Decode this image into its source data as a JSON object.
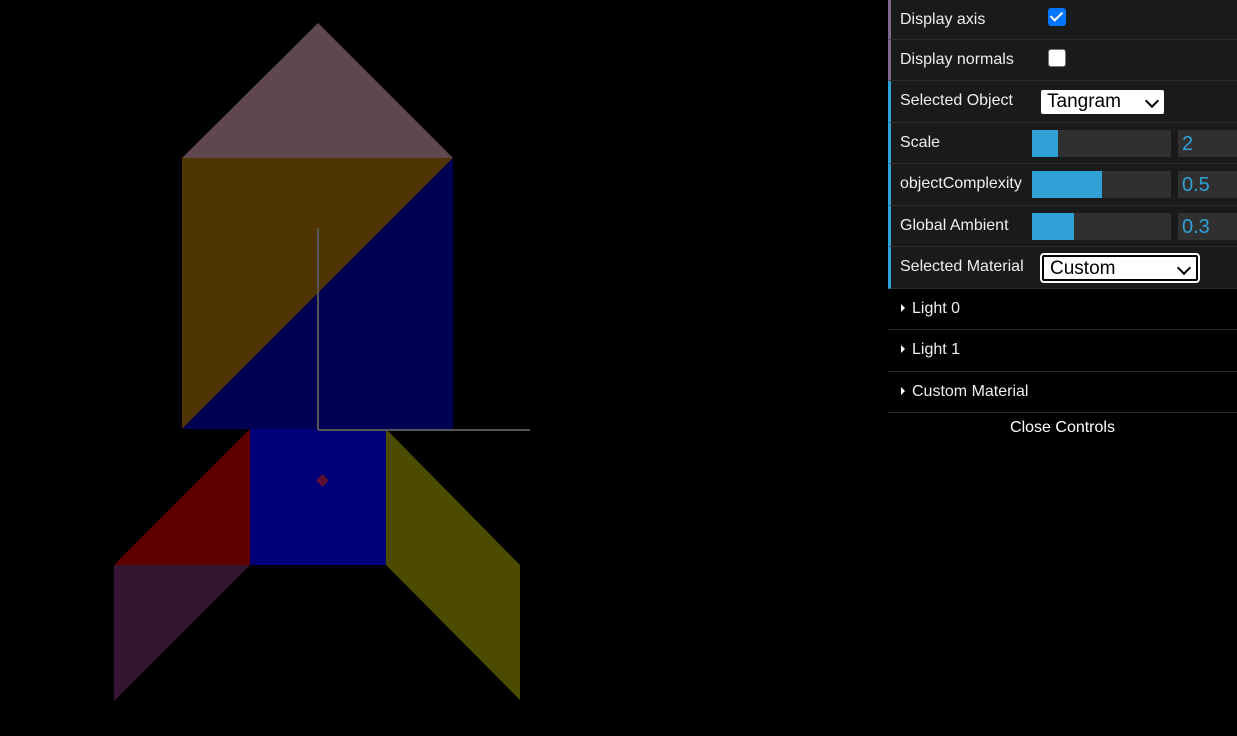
{
  "controls": {
    "display_axis": {
      "label": "Display axis",
      "checked": true
    },
    "display_normals": {
      "label": "Display normals",
      "checked": false
    },
    "selected_object": {
      "label": "Selected Object",
      "value": "Tangram"
    },
    "scale": {
      "label": "Scale",
      "value": "2",
      "fraction": 0.19
    },
    "object_complexity": {
      "label": "objectComplexity",
      "value": "0.5",
      "fraction": 0.5
    },
    "global_ambient": {
      "label": "Global Ambient",
      "value": "0.3",
      "fraction": 0.3
    },
    "selected_material": {
      "label": "Selected Material",
      "value": "Custom"
    }
  },
  "folders": [
    {
      "label": "Light 0"
    },
    {
      "label": "Light 1"
    },
    {
      "label": "Custom Material"
    }
  ],
  "close_label": "Close Controls",
  "colors": {
    "panel_accent": "#2fa1d6",
    "bool_accent": "#806787",
    "tangram_roof": "#5e474d",
    "tangram_orange": "#4f3500",
    "tangram_blue": "#000054",
    "tangram_square": "#00007a",
    "tangram_red": "#5e0000",
    "tangram_purple": "#361532",
    "tangram_yellow": "#4c4b00"
  }
}
